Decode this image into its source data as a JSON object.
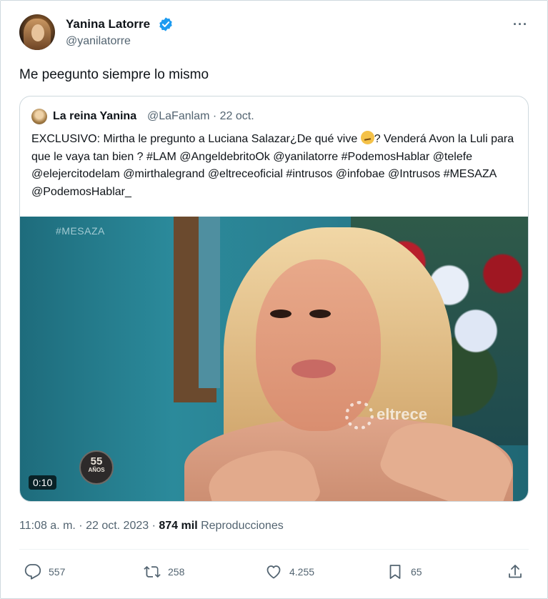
{
  "author": {
    "name": "Yanina Latorre",
    "handle": "@yanilatorre",
    "verified_icon": "verified-badge-icon",
    "verified_color": "#1d9bf0"
  },
  "more_label": "···",
  "tweet": {
    "text": "Me peegunto siempre lo mismo"
  },
  "quoted": {
    "name": "La reina Yanina",
    "meta": "@LaFanlam · 22 oct.",
    "text_part1": "EXCLUSIVO: Mirtha le pregunto a Luciana Salazar¿De qué vive ",
    "emoji": "thinking-face-emoji",
    "text_part2": "? Venderá Avon la Luli para que le vaya tan bien ? #LAM @AngeldebritoOk @yanilatorre #PodemosHablar @telefe @elejercitodelam @mirthalegrand @eltreceoficial #intrusos @infobae @Intrusos #MESAZA @PodemosHablar_",
    "video": {
      "overlay_tag": "#MESAZA",
      "channel_logo": "eltrece",
      "badge_number": "55",
      "badge_text": "AÑOS",
      "duration": "0:10"
    }
  },
  "meta": {
    "time_date": "11:08 a. m. · 22 oct. 2023 · ",
    "views_count": "874 mil",
    "views_label": " Reproducciones"
  },
  "actions": {
    "reply_count": "557",
    "retweet_count": "258",
    "like_count": "4.255",
    "bookmark_count": "65"
  },
  "colors": {
    "text_primary": "#0f1419",
    "text_secondary": "#536471",
    "border": "#cfd9de",
    "accent": "#1d9bf0"
  }
}
